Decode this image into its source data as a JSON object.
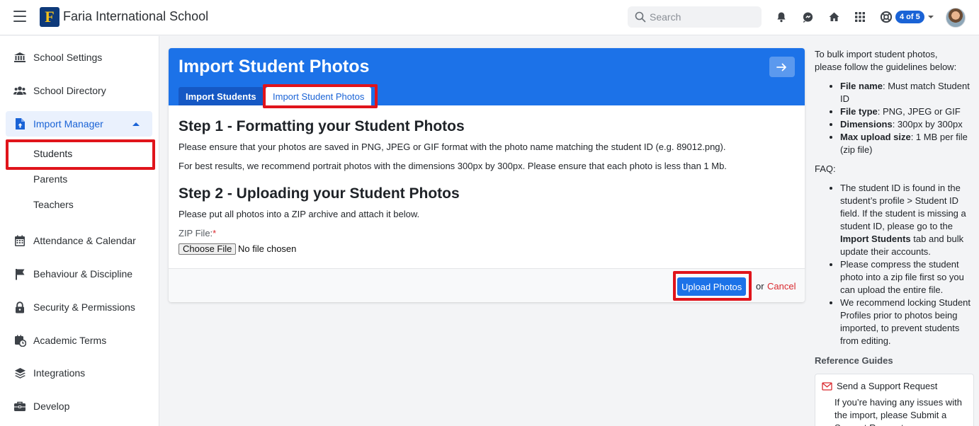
{
  "header": {
    "school_name": "Faria International School",
    "logo_letter": "F",
    "search_placeholder": "Search",
    "badge_label": "4 of 5"
  },
  "sidebar": {
    "items": [
      {
        "label": "School Settings",
        "icon": "bank-icon"
      },
      {
        "label": "School Directory",
        "icon": "users-icon"
      },
      {
        "label": "Import Manager",
        "icon": "file-upload-icon",
        "active": true
      },
      {
        "label": "Attendance & Calendar",
        "icon": "calendar-icon"
      },
      {
        "label": "Behaviour & Discipline",
        "icon": "flag-icon"
      },
      {
        "label": "Security & Permissions",
        "icon": "lock-icon"
      },
      {
        "label": "Academic Terms",
        "icon": "calendar-clock-icon"
      },
      {
        "label": "Integrations",
        "icon": "layers-icon"
      },
      {
        "label": "Develop",
        "icon": "toolbox-icon"
      }
    ],
    "sub_items": [
      {
        "label": "Students",
        "selected": true
      },
      {
        "label": "Parents"
      },
      {
        "label": "Teachers"
      }
    ]
  },
  "main": {
    "title": "Import Student Photos",
    "tabs": [
      {
        "label": "Import Students"
      },
      {
        "label": "Import Student Photos",
        "active": true
      }
    ],
    "step1_heading": "Step 1 - Formatting your Student Photos",
    "step1_p1": "Please ensure that your photos are saved in PNG, JPEG or GIF format with the photo name matching the student ID (e.g. 89012.png).",
    "step1_p2": "For best results, we recommend portrait photos with the dimensions 300px by 300px. Please ensure that each photo is less than 1 Mb.",
    "step2_heading": "Step 2 - Uploading your Student Photos",
    "step2_p1": "Please put all photos into a ZIP archive and attach it below.",
    "zip_label": "ZIP File:",
    "required_mark": "*",
    "choose_file_label": "Choose File",
    "no_file_text": "No file chosen",
    "upload_label": "Upload Photos",
    "or_text": "or",
    "cancel_label": "Cancel"
  },
  "right_panel": {
    "intro": "To bulk import student photos, please follow the guidelines below:",
    "guidelines": [
      {
        "term": "File name",
        "text": ": Must match Student ID"
      },
      {
        "term": "File type",
        "text": ": PNG, JPEG or GIF"
      },
      {
        "term": "Dimensions",
        "text": ": 300px by 300px"
      },
      {
        "term": "Max upload size",
        "text": ": 1 MB per file (zip file)"
      }
    ],
    "faq_title": "FAQ:",
    "faq_1_a": "The student ID is found in the student’s profile > Student ID field. If the student is missing a student ID, please go to the ",
    "faq_1_b": "Import Students",
    "faq_1_c": " tab and bulk update their accounts.",
    "faq_2": "Please compress the student photo into a zip file first so you can upload the entire file.",
    "faq_3": "We recommend locking Student Profiles prior to photos being imported, to prevent students from editing.",
    "reference_title": "Reference Guides",
    "support_title": "Send a Support Request",
    "support_text": "If you’re having any issues with the import, please Submit a Support Request so we can"
  },
  "colors": {
    "brand_blue": "#1c72e8",
    "highlight_red": "#e0141b",
    "cancel_red": "#d9292e"
  }
}
